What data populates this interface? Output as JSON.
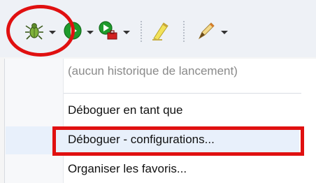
{
  "colors": {
    "annotation_red": "#e01010",
    "run_green": "#1f9b2c",
    "menu_background": "#ffffff",
    "toolbar_background": "#eef1f6"
  },
  "toolbar": {
    "items": [
      {
        "name": "debug",
        "icon": "bug-icon"
      },
      {
        "name": "run",
        "icon": "play-icon"
      },
      {
        "name": "external-tools",
        "icon": "run-with-toolbox-icon"
      },
      {
        "name": "highlighter",
        "icon": "highlighter-icon"
      },
      {
        "name": "pen",
        "icon": "pen-icon"
      }
    ]
  },
  "menu": {
    "history_placeholder": "(aucun historique de lancement)",
    "debug_as": "Déboguer en tant que",
    "debug_configurations": "Déboguer - configurations...",
    "organize_favorites": "Organiser les favoris..."
  }
}
